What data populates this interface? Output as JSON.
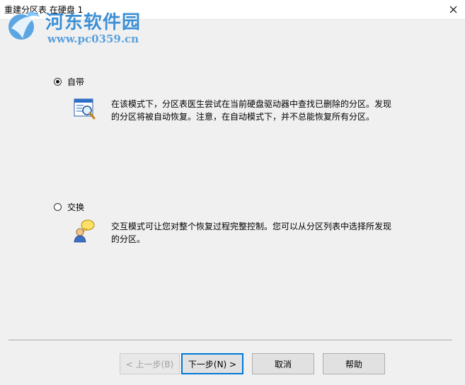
{
  "window": {
    "title": "重建分区表 在硬盘 1"
  },
  "watermark": {
    "name": "河东软件园",
    "url": "www.pc0359.cn"
  },
  "options": [
    {
      "label": "自带",
      "selected": true,
      "icon": "magnifier-window-icon",
      "description_line1": "在该模式下，分区表医生尝试在当前硬盘驱动器中查找已删除的分区。发现",
      "description_line2": "的分区将被自动恢复。注意，在自动模式下，并不总能恢复所有分区。"
    },
    {
      "label": "交换",
      "selected": false,
      "icon": "user-chat-icon",
      "description_line1": "交互模式可让您对整个恢复过程完整控制。您可以从分区列表中选择所发现",
      "description_line2": "的分区。"
    }
  ],
  "buttons": {
    "back": "< 上一步(B)",
    "next": "下一步(N) >",
    "cancel": "取消",
    "help": "帮助"
  },
  "colors": {
    "background": "#f0f0f0",
    "accent": "#0078d7",
    "watermark": "#3d8fd4"
  }
}
